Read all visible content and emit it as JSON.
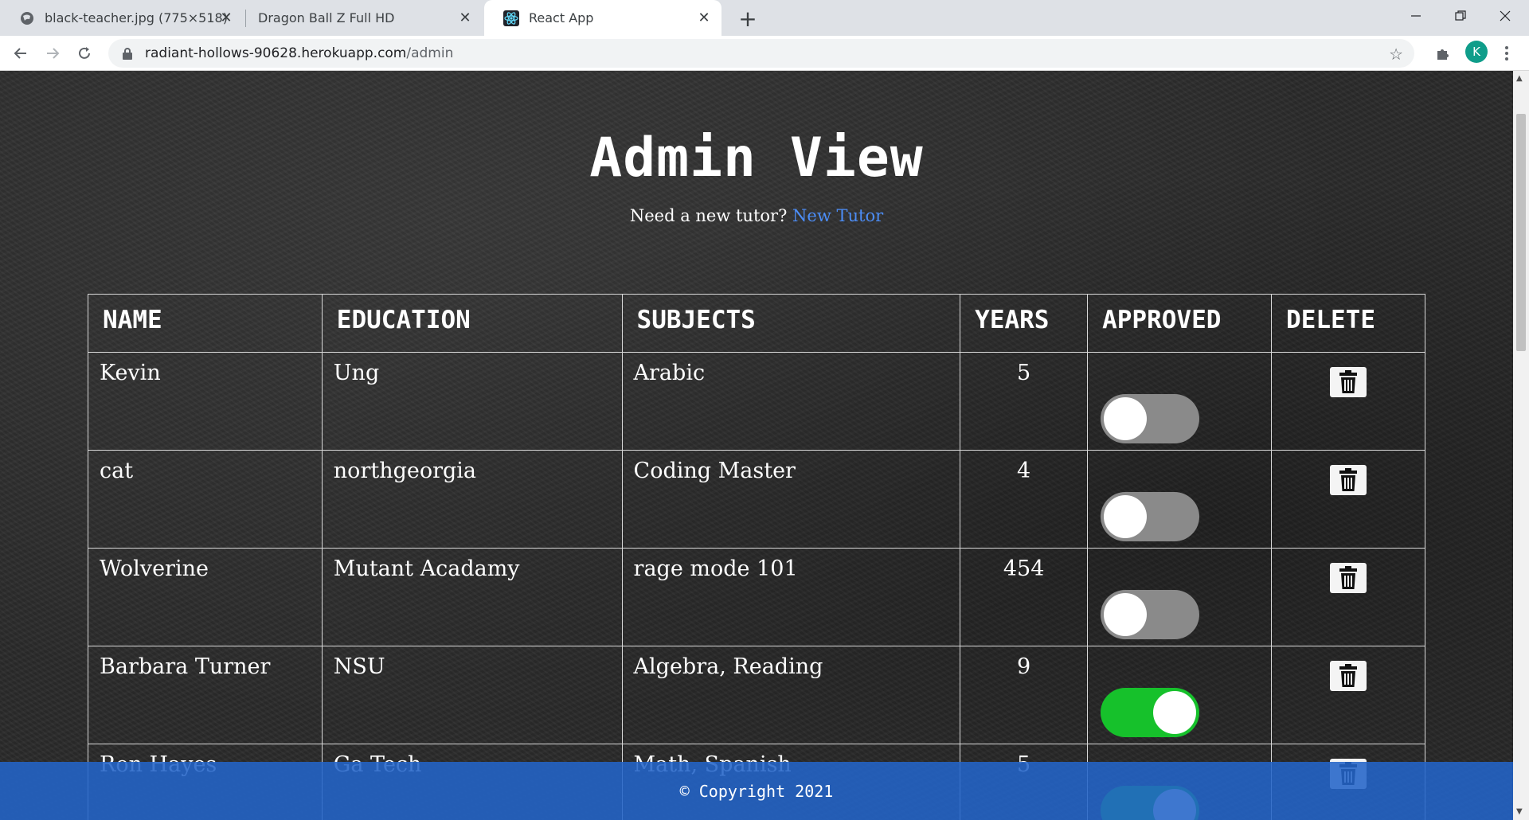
{
  "browser": {
    "tabs": [
      {
        "title": "black-teacher.jpg (775×518)",
        "icon": "globe-icon"
      },
      {
        "title": "Dragon Ball Z Full HD",
        "icon": ""
      },
      {
        "title": "React App",
        "icon": "react-icon"
      }
    ],
    "url_host": "radiant-hollows-90628.herokuapp.com",
    "url_path": "/admin",
    "profile_initial": "K"
  },
  "page": {
    "title": "Admin View",
    "subtitle_text": "Need a new tutor?",
    "subtitle_link": "New Tutor"
  },
  "table": {
    "headers": [
      "NAME",
      "EDUCATION",
      "SUBJECTS",
      "YEARS",
      "APPROVED",
      "DELETE"
    ],
    "rows": [
      {
        "name": "Kevin",
        "education": "Ung",
        "subjects": "Arabic",
        "years": "5",
        "approved": false
      },
      {
        "name": "cat",
        "education": "northgeorgia",
        "subjects": "Coding Master",
        "years": "4",
        "approved": false
      },
      {
        "name": "Wolverine",
        "education": "Mutant Acadamy",
        "subjects": "rage mode 101",
        "years": "454",
        "approved": false
      },
      {
        "name": "Barbara Turner",
        "education": "NSU",
        "subjects": "Algebra, Reading",
        "years": "9",
        "approved": true
      },
      {
        "name": "Ron Hayes",
        "education": "Ga Tech",
        "subjects": "Math, Spanish",
        "years": "5",
        "approved": true
      }
    ]
  },
  "footer": {
    "text": "© Copyright 2021"
  },
  "colors": {
    "toggle_on": "#16c12b",
    "toggle_off": "#8a8a8a",
    "link": "#4c8df6",
    "footer": "#2364c8"
  }
}
